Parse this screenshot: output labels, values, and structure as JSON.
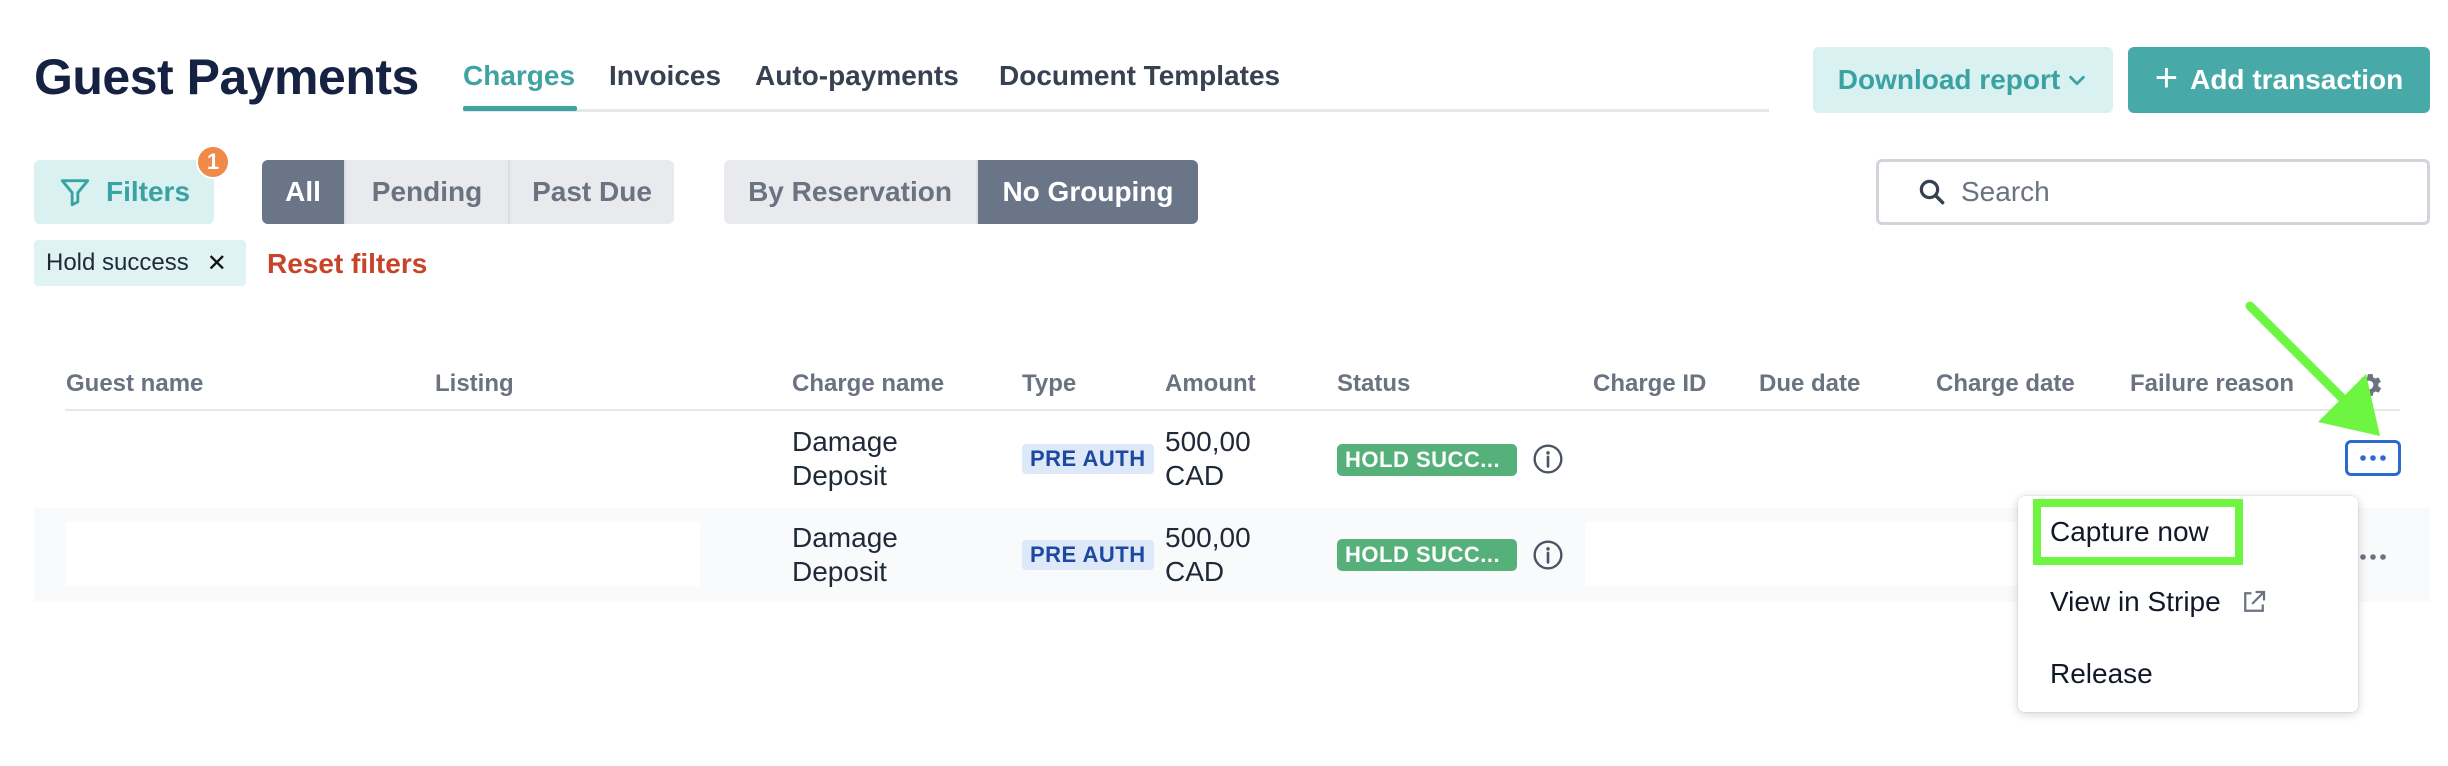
{
  "header": {
    "title": "Guest Payments",
    "tabs": [
      {
        "label": "Charges",
        "active": true
      },
      {
        "label": "Invoices",
        "active": false
      },
      {
        "label": "Auto-payments",
        "active": false
      },
      {
        "label": "Document Templates",
        "active": false
      }
    ],
    "download_label": "Download report",
    "add_label": "Add transaction"
  },
  "filters": {
    "filters_label": "Filters",
    "filters_count": "1",
    "status_segments": [
      "All",
      "Pending",
      "Past Due"
    ],
    "status_selected": "All",
    "grouping_segments": [
      "By Reservation",
      "No Grouping"
    ],
    "grouping_selected": "No Grouping",
    "search_placeholder": "Search",
    "active_chip": "Hold success",
    "reset_label": "Reset filters"
  },
  "table": {
    "columns": [
      "Guest name",
      "Listing",
      "Charge name",
      "Type",
      "Amount",
      "Status",
      "Charge ID",
      "Due date",
      "Charge date",
      "Failure reason"
    ],
    "rows": [
      {
        "guest": "",
        "listing": "",
        "charge_name_1": "Damage",
        "charge_name_2": "Deposit",
        "type": "PRE AUTH",
        "amount_1": "500,00",
        "amount_2": "CAD",
        "status": "HOLD SUCC..."
      },
      {
        "guest": "",
        "listing": "",
        "charge_name_1": "Damage",
        "charge_name_2": "Deposit",
        "type": "PRE AUTH",
        "amount_1": "500,00",
        "amount_2": "CAD",
        "status": "HOLD SUCC..."
      }
    ]
  },
  "menu": {
    "items": [
      "Capture now",
      "View in Stripe",
      "Release"
    ]
  },
  "colors": {
    "accent": "#3fa3a2",
    "primary_button": "#47aaa9",
    "status_success": "#56b07a",
    "danger_text": "#c7432a",
    "highlight": "#6ef542",
    "badge": "#ef8a4a"
  },
  "icons": {
    "download_caret": "chevron-down-icon",
    "add": "plus-icon",
    "filter": "filter-funnel-icon",
    "search": "search-icon",
    "remove_chip": "close-icon",
    "settings": "gear-icon",
    "info": "info-icon",
    "more": "more-horizontal-icon",
    "external": "external-link-icon",
    "annotation": "arrow-icon"
  }
}
